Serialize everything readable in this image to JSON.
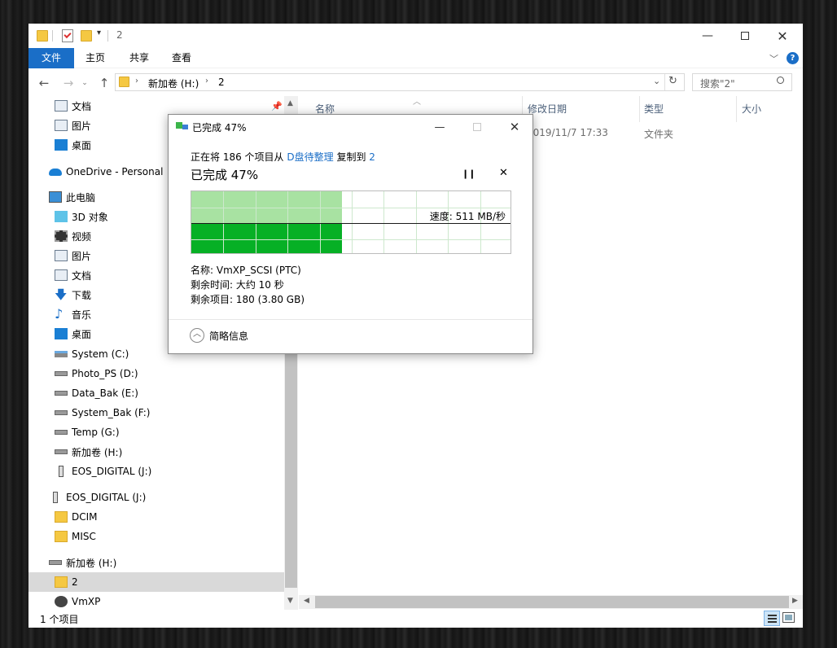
{
  "window": {
    "title": "2",
    "tabs": {
      "file": "文件",
      "home": "主页",
      "share": "共享",
      "view": "查看"
    }
  },
  "address": {
    "path": [
      "新加卷 (H:)",
      "2"
    ],
    "search_placeholder": "搜索\"2\""
  },
  "sidebar": {
    "items": [
      {
        "label": "文档",
        "icon": "documents-icon"
      },
      {
        "label": "图片",
        "icon": "pictures-icon"
      },
      {
        "label": "桌面",
        "icon": "desktop-icon"
      },
      {
        "label": "OneDrive - Personal",
        "icon": "onedrive-icon"
      },
      {
        "label": "此电脑",
        "icon": "this-pc-icon"
      },
      {
        "label": "3D 对象",
        "icon": "3d-objects-icon"
      },
      {
        "label": "视频",
        "icon": "videos-icon"
      },
      {
        "label": "图片",
        "icon": "pictures-icon"
      },
      {
        "label": "文档",
        "icon": "documents-icon"
      },
      {
        "label": "下载",
        "icon": "downloads-icon"
      },
      {
        "label": "音乐",
        "icon": "music-icon"
      },
      {
        "label": "桌面",
        "icon": "desktop-icon"
      },
      {
        "label": "System (C:)",
        "icon": "system-drive-icon"
      },
      {
        "label": "Photo_PS (D:)",
        "icon": "drive-icon"
      },
      {
        "label": "Data_Bak (E:)",
        "icon": "drive-icon"
      },
      {
        "label": "System_Bak (F:)",
        "icon": "drive-icon"
      },
      {
        "label": "Temp (G:)",
        "icon": "drive-icon"
      },
      {
        "label": "新加卷 (H:)",
        "icon": "drive-icon"
      },
      {
        "label": "EOS_DIGITAL (J:)",
        "icon": "removable-drive-icon"
      },
      {
        "label": "EOS_DIGITAL (J:)",
        "icon": "removable-drive-icon"
      },
      {
        "label": "DCIM",
        "icon": "folder-icon"
      },
      {
        "label": "MISC",
        "icon": "folder-icon"
      },
      {
        "label": "新加卷 (H:)",
        "icon": "drive-icon"
      },
      {
        "label": "2",
        "icon": "folder-icon"
      },
      {
        "label": "VmXP",
        "icon": "vm-drive-icon"
      }
    ]
  },
  "columns": {
    "name": "名称",
    "date": "修改日期",
    "type": "类型",
    "size": "大小"
  },
  "files": [
    {
      "date": "2019/11/7 17:33",
      "type": "文件夹"
    }
  ],
  "status": {
    "count": "1 个项目"
  },
  "dialog": {
    "title": "已完成 47%",
    "line_prefix": "正在将 186 个项目从",
    "source": "D盘待整理",
    "line_mid": "复制到",
    "dest": "2",
    "progress_heading": "已完成 47%",
    "progress_fraction": 0.47,
    "speed": "速度: 511 MB/秒",
    "name_line": "名称: VmXP_SCSI (PTC)",
    "time_line": "剩余时间: 大约 10 秒",
    "items_line": "剩余项目: 180 (3.80 GB)",
    "less_details": "简略信息"
  },
  "colors": {
    "accent": "#1a6ec7",
    "progress": "#06b025",
    "progress_light": "#a8e2a2"
  }
}
